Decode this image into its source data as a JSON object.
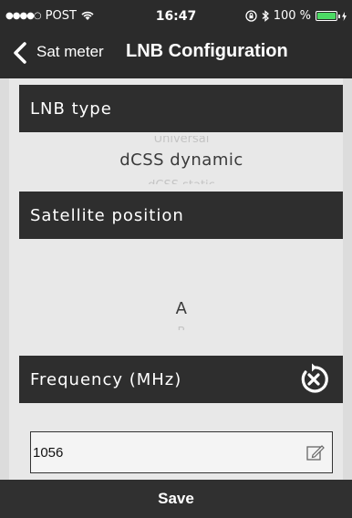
{
  "status_bar": {
    "signal_dots": "●●●●○",
    "carrier": "POST",
    "wifi_icon": "wifi-icon",
    "time": "16:47",
    "battery_percent": "100 %",
    "battery_level": 1.0
  },
  "nav": {
    "back_label": "Sat meter",
    "title": "LNB Configuration"
  },
  "lnb_type": {
    "header": "LNB type",
    "options_visible": [
      "Universal",
      "dCSS dynamic",
      "dCSS static"
    ],
    "selected": "dCSS dynamic"
  },
  "satellite_position": {
    "header": "Satellite position",
    "options_visible": [
      "A",
      "B"
    ],
    "selected": "A"
  },
  "frequency": {
    "header": "Frequency (MHz)",
    "value": "1056",
    "reset_icon": "reset-icon",
    "edit_icon": "edit-icon"
  },
  "footer": {
    "save_label": "Save"
  },
  "colors": {
    "header_bg": "#2b2b2b",
    "section_bg": "#2e2e2e",
    "content_bg": "#e8e8e8",
    "battery": "#4cd964"
  }
}
